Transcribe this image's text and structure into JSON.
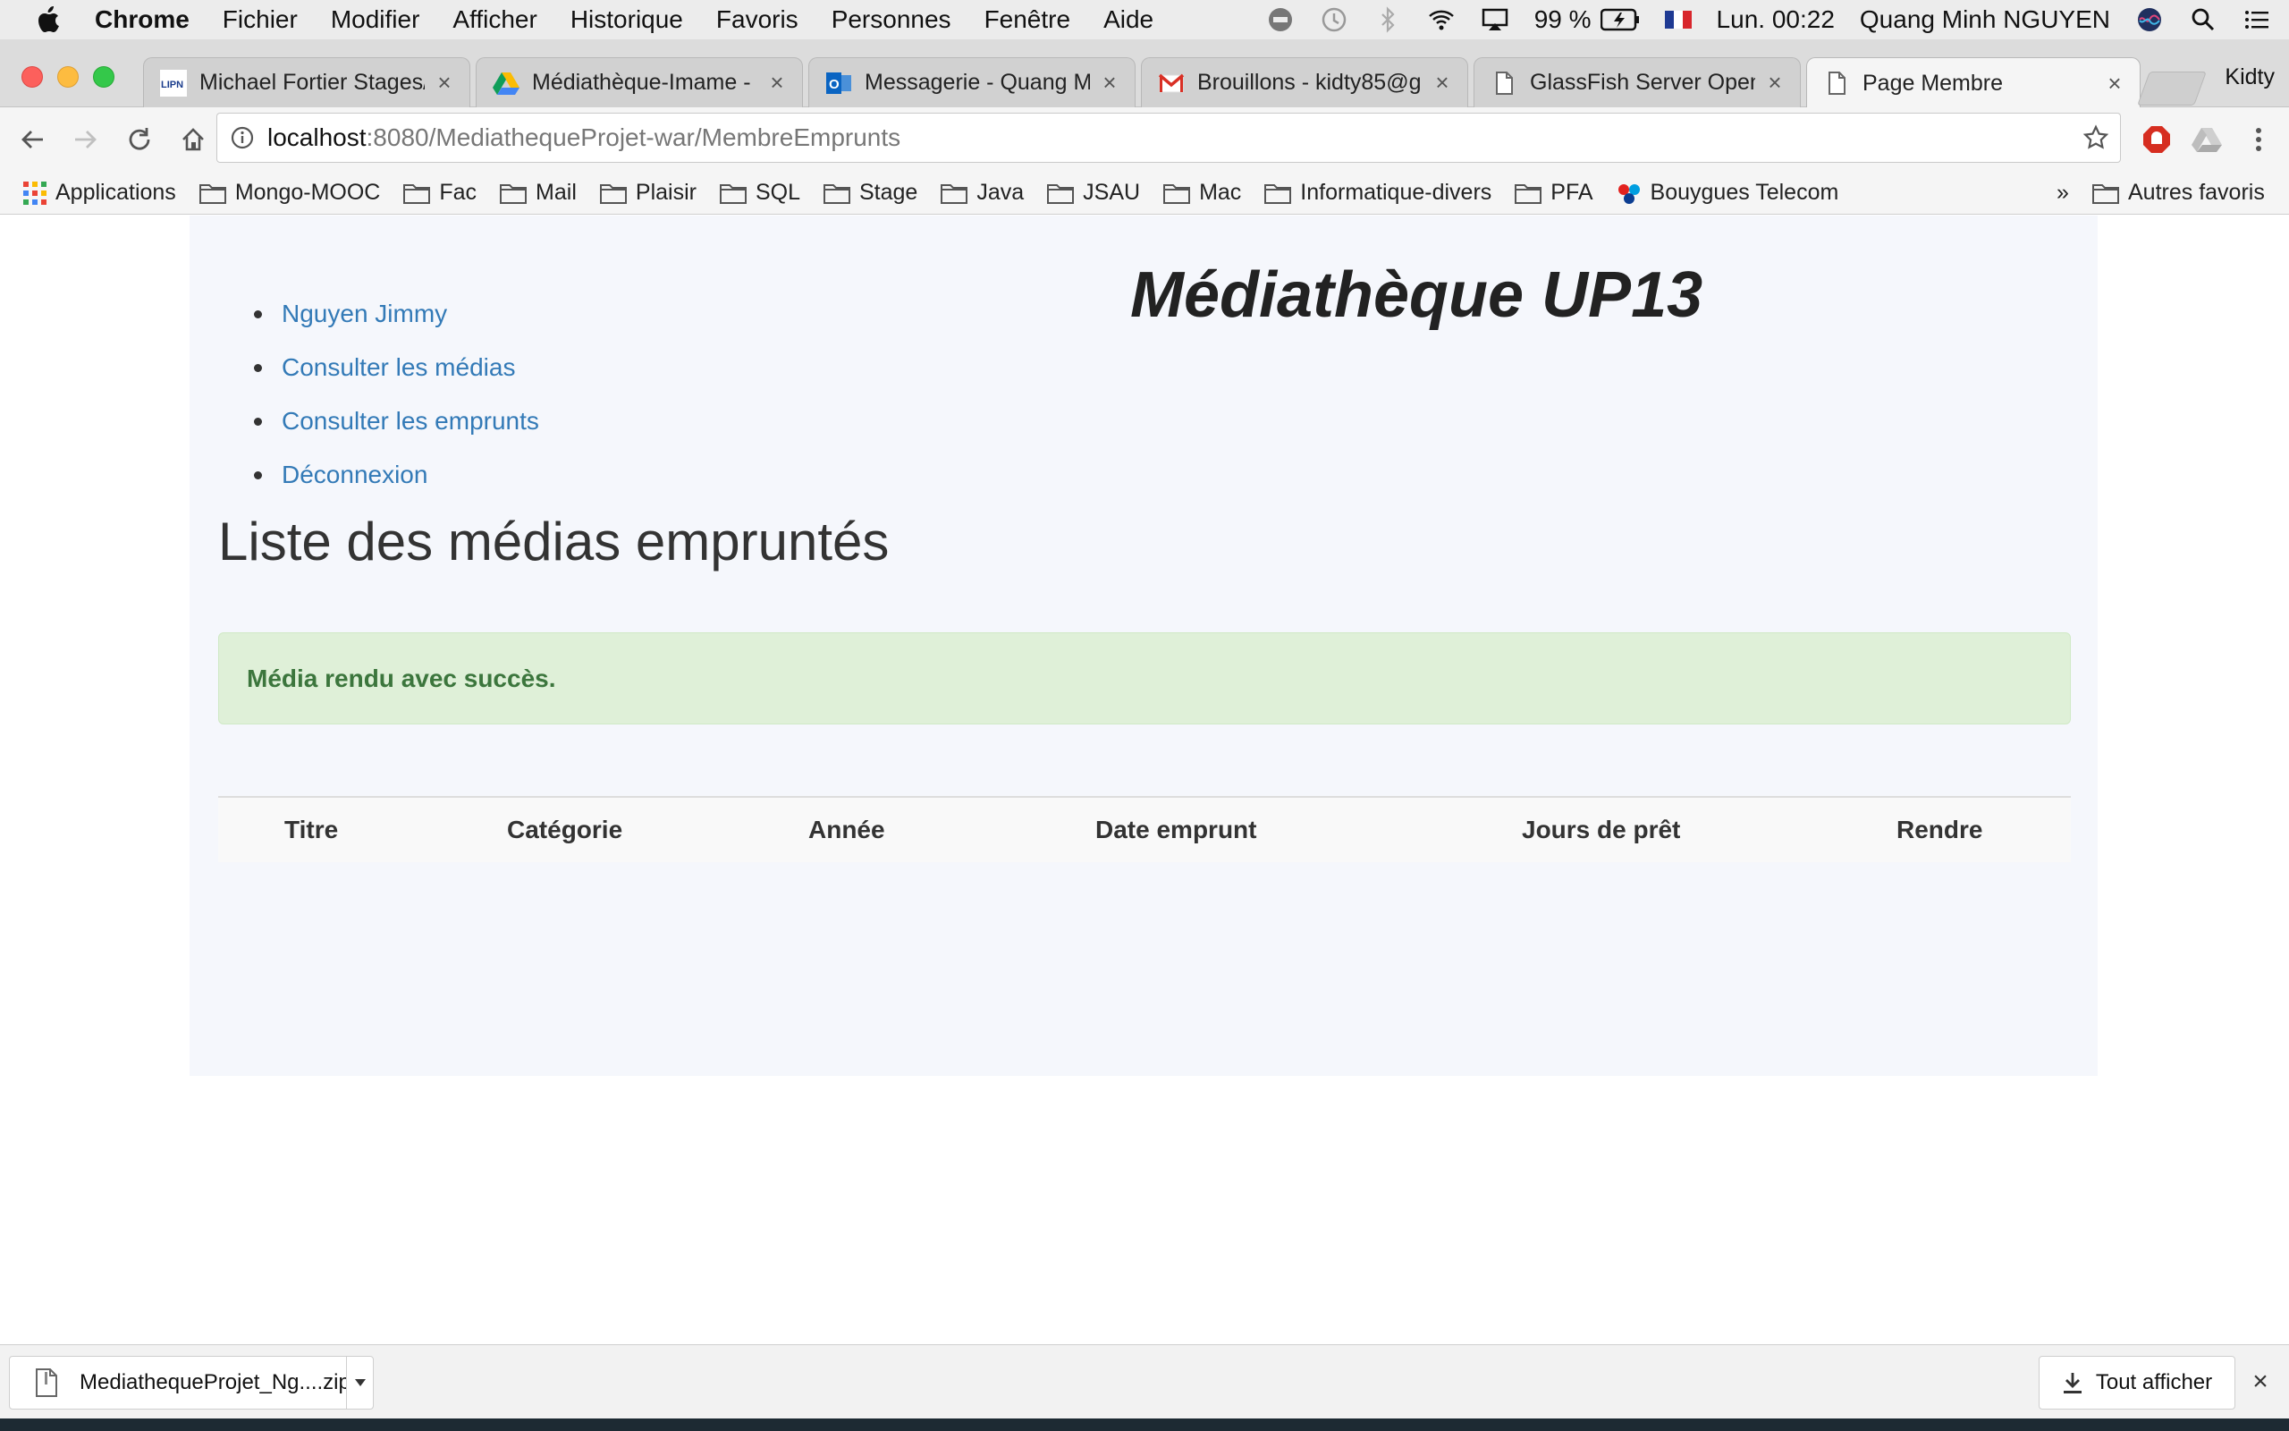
{
  "menubar": {
    "app_name": "Chrome",
    "items": [
      "Fichier",
      "Modifier",
      "Afficher",
      "Historique",
      "Favoris",
      "Personnes",
      "Fenêtre",
      "Aide"
    ],
    "battery": "99 %",
    "clock": "Lun. 00:22",
    "user": "Quang Minh NGUYEN"
  },
  "tabs": [
    {
      "label": "Michael Fortier Stages/",
      "icon": "lipn-favicon"
    },
    {
      "label": "Médiathèque-Imame - I",
      "icon": "google-drive-favicon"
    },
    {
      "label": "Messagerie - Quang Mi",
      "icon": "outlook-favicon"
    },
    {
      "label": "Brouillons - kidty85@g",
      "icon": "gmail-favicon"
    },
    {
      "label": "GlassFish Server Open",
      "icon": "page-favicon"
    },
    {
      "label": "Page Membre",
      "icon": "page-favicon",
      "active": true
    }
  ],
  "profile_name": "Kidty",
  "address": {
    "host": "localhost",
    "rest": ":8080/MediathequeProjet-war/MembreEmprunts"
  },
  "bookmarks": {
    "apps_label": "Applications",
    "folders": [
      "Mongo-MOOC",
      "Fac",
      "Mail",
      "Plaisir",
      "SQL",
      "Stage",
      "Java",
      "JSAU",
      "Mac",
      "Informatique-divers",
      "PFA"
    ],
    "site": "Bouygues Telecom",
    "overflow": "»",
    "other": "Autres favoris"
  },
  "page": {
    "site_title": "Médiathèque UP13",
    "nav": [
      "Nguyen Jimmy",
      "Consulter les médias",
      "Consulter les emprunts",
      "Déconnexion"
    ],
    "heading": "Liste des médias empruntés",
    "alert": "Média rendu avec succès.",
    "table": {
      "headers": [
        "Titre",
        "Catégorie",
        "Année",
        "Date emprunt",
        "Jours de prêt",
        "Rendre"
      ],
      "rows": []
    }
  },
  "downloads": {
    "file": "MediathequeProjet_Ng....zip",
    "show_all": "Tout afficher",
    "close": "×"
  }
}
